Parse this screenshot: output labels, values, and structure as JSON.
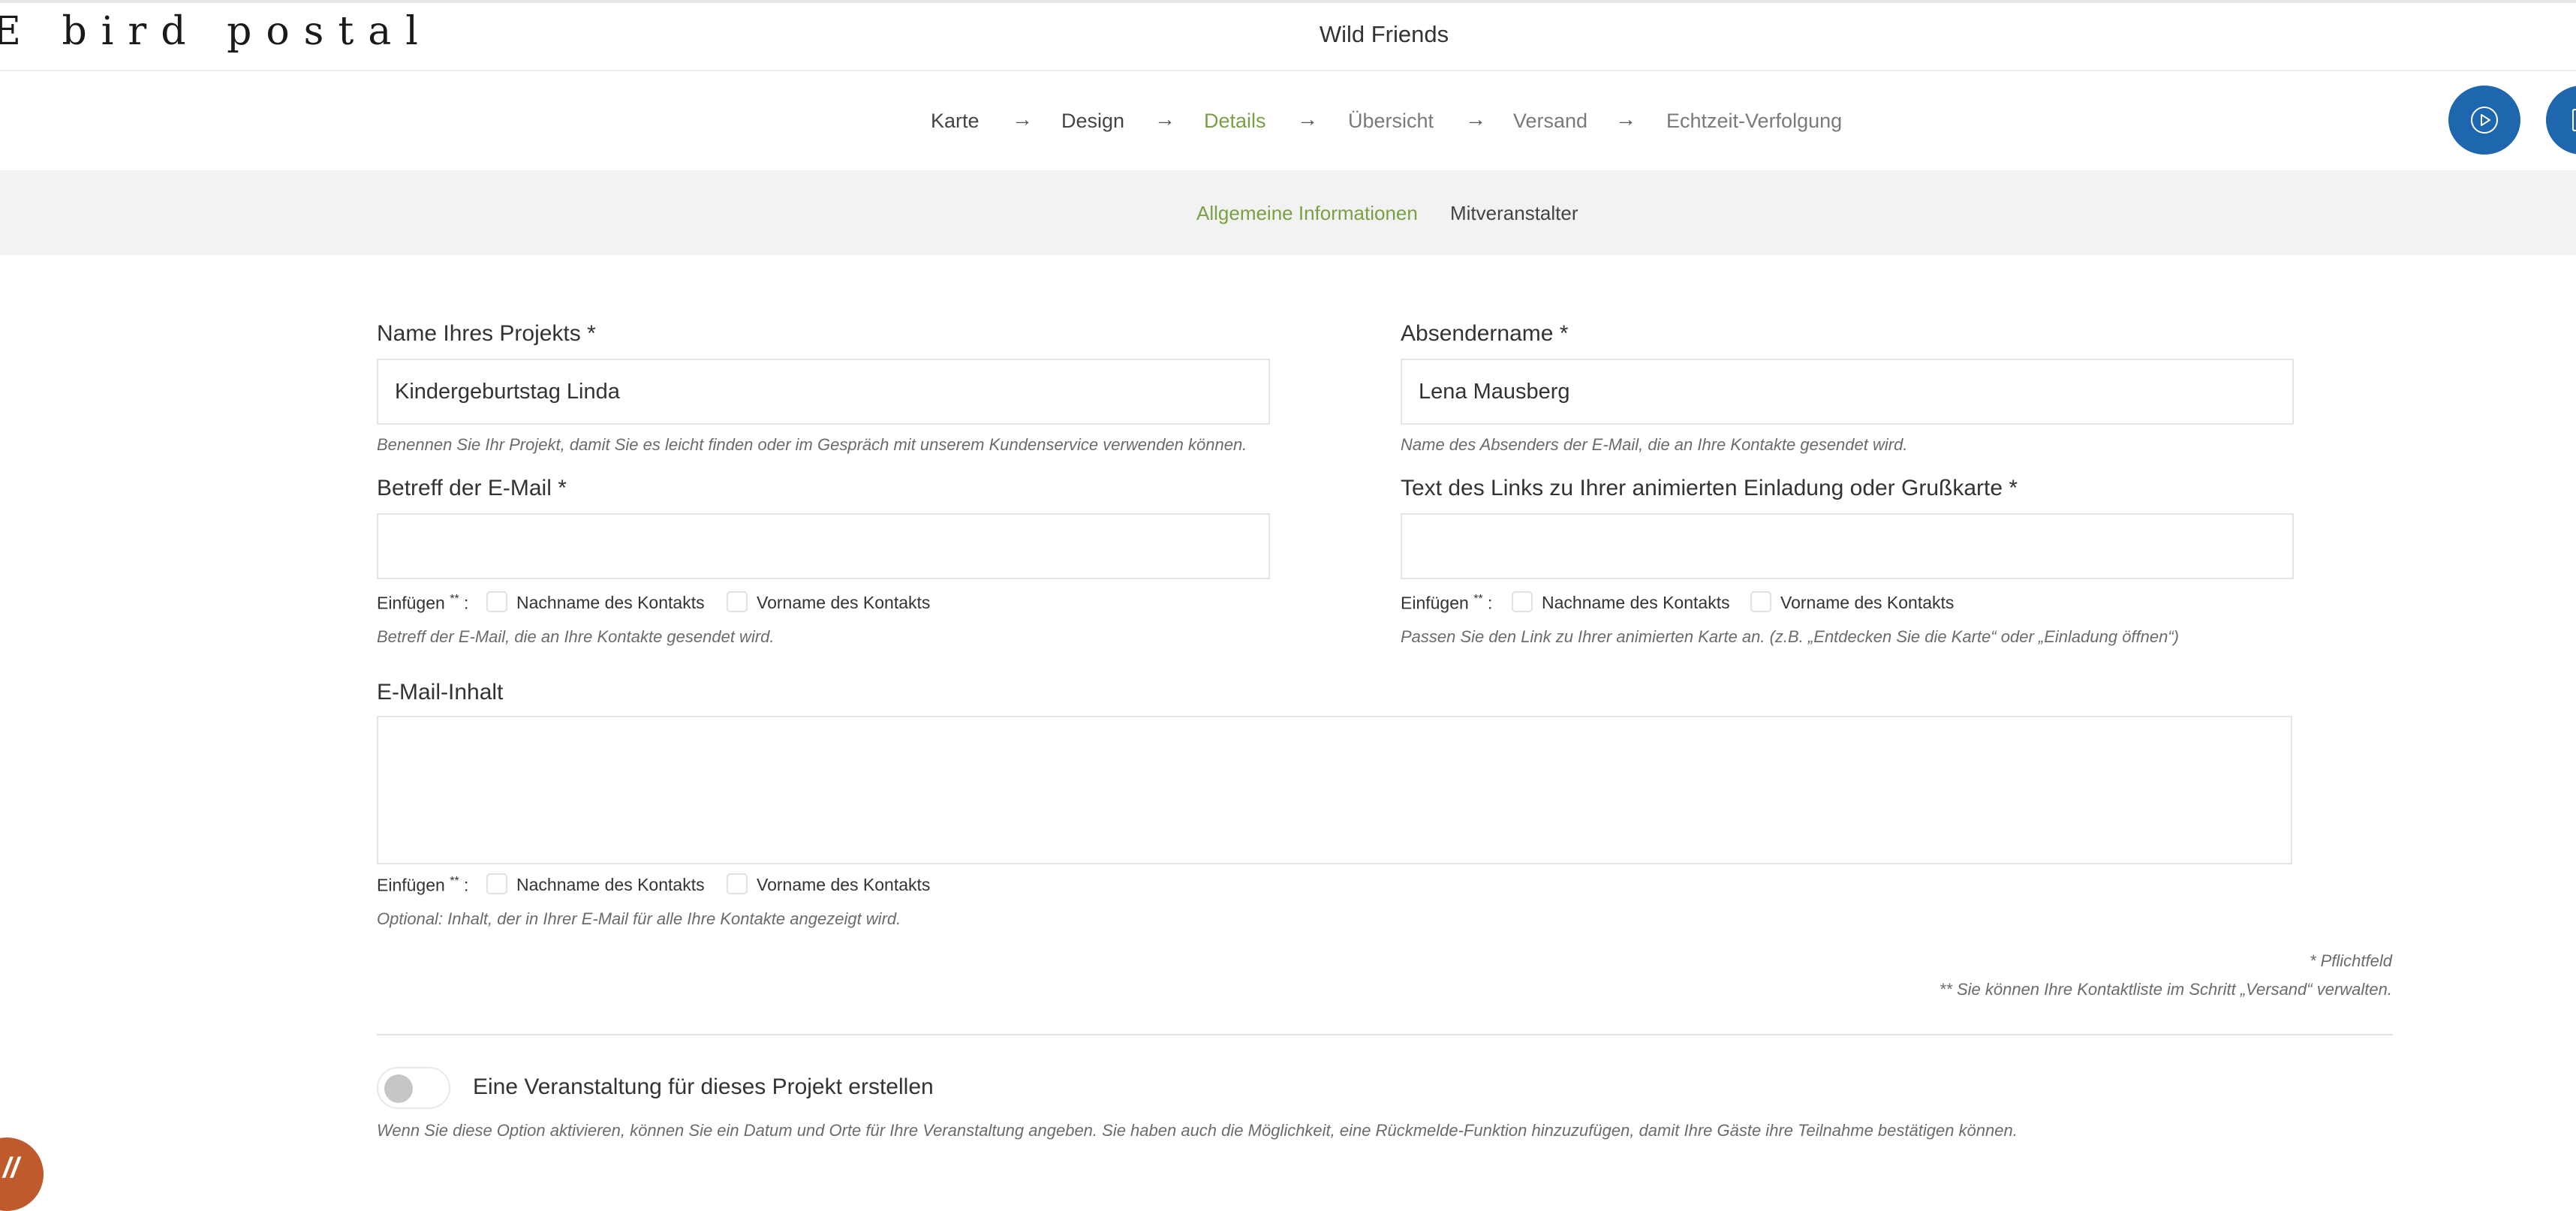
{
  "header": {
    "logo_text": "E bird postal",
    "title": "Wild Friends"
  },
  "steps": [
    {
      "label": "Karte",
      "state": "done"
    },
    {
      "label": "Design",
      "state": "done"
    },
    {
      "label": "Details",
      "state": "active"
    },
    {
      "label": "Übersicht",
      "state": "todo"
    },
    {
      "label": "Versand",
      "state": "todo"
    },
    {
      "label": "Echtzeit-Verfolgung",
      "state": "todo"
    }
  ],
  "step_arrow": "→",
  "header_buttons": [
    "play-icon",
    "document-icon"
  ],
  "subnav": {
    "tabs": [
      "Allgemeine Informationen",
      "Mitveranstalter"
    ]
  },
  "colors": {
    "accent_green": "#79a044",
    "primary_blue": "#1e66ad",
    "badge_orange": "#bf5a2c"
  },
  "form": {
    "project_name": {
      "label": "Name Ihres Projekts *",
      "value": "Kindergeburtstag Linda",
      "hint": "Benennen Sie Ihr Projekt, damit Sie es leicht finden oder im Gespräch mit unserem Kundenservice verwenden können."
    },
    "sender_name": {
      "label": "Absendername *",
      "value": "Lena Mausberg",
      "hint": "Name des Absenders der E-Mail, die an Ihre Kontakte gesendet wird."
    },
    "subject": {
      "label": "Betreff der E-Mail *",
      "value": "",
      "hint": "Betreff der E-Mail, die an Ihre Kontakte gesendet wird."
    },
    "link_text": {
      "label": "Text des Links zu Ihrer animierten Einladung oder Grußkarte *",
      "value": "",
      "hint": "Passen Sie den Link zu Ihrer animierten Karte an. (z.B. „Entdecken Sie die Karte“ oder „Einladung öffnen“)"
    },
    "body": {
      "label": "E-Mail-Inhalt",
      "value": "",
      "hint": "Optional: Inhalt, der in Ihrer E-Mail für alle Ihre Kontakte angezeigt wird."
    },
    "insert": {
      "label": "Einfügen",
      "stars": "**",
      "colon": ":",
      "last_name": "Nachname des Kontakts",
      "first_name": "Vorname des Kontakts"
    },
    "required_note": "* Pflichtfeld",
    "contacts_note": "** Sie können Ihre Kontaktliste im Schritt „Versand“ verwalten.",
    "event": {
      "label": "Eine Veranstaltung für dieses Projekt erstellen",
      "enabled": false,
      "hint": "Wenn Sie diese Option aktivieren, können Sie ein Datum und Orte für Ihre Veranstaltung angeben. Sie haben auch die Möglichkeit, eine Rückmelde-Funktion hinzuzufügen, damit Ihre Gäste ihre Teilnahme bestätigen können."
    }
  }
}
